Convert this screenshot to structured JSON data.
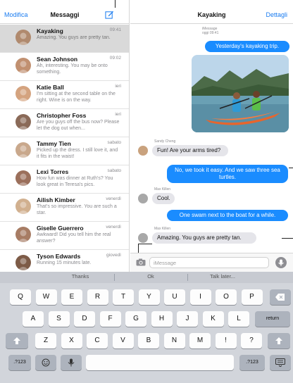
{
  "list_header": {
    "edit_label": "Modifica",
    "title": "Messaggi",
    "compose_icon": "compose-icon"
  },
  "conversations": [
    {
      "name": "Kayaking",
      "time": "09:41",
      "preview": "Amazing. You guys are pretty tan.",
      "selected": true
    },
    {
      "name": "Sean Johnson",
      "time": "09:02",
      "preview": "Ah, interesting. You may be onto something."
    },
    {
      "name": "Katie Ball",
      "time": "ieri",
      "preview": "I'm sitting at the second table on the right. Wine is on the way."
    },
    {
      "name": "Christopher Foss",
      "time": "ieri",
      "preview": "Are you guys off the bus now? Please let the dog out when..."
    },
    {
      "name": "Tammy Tien",
      "time": "sabato",
      "preview": "Picked up the dress. I still love it, and it fits in the waist!"
    },
    {
      "name": "Lexi Torres",
      "time": "sabato",
      "preview": "How fun was dinner at Ruth's? You look great in Teresa's pics."
    },
    {
      "name": "Ailish Kimber",
      "time": "venerdì",
      "preview": "That's so impressive. You are such a star."
    },
    {
      "name": "Giselle Guerrero",
      "time": "venerdì",
      "preview": "Awkward! Did you tell him the real answer?"
    },
    {
      "name": "Tyson Edwards",
      "time": "giovedì",
      "preview": "Running 15 minutes late."
    }
  ],
  "chat_header": {
    "title": "Kayaking",
    "details_label": "Dettagli"
  },
  "chat": {
    "imessage_label": "iMessage",
    "imessage_time": "oggi 09:41",
    "messages": [
      {
        "direction": "out",
        "text": "Yesterday's kayaking trip."
      },
      {
        "direction": "in",
        "sender": "Sandy Cheng",
        "text": "Fun! Are your arms tired?"
      },
      {
        "direction": "out",
        "text": "No, we took it easy. And we saw three sea turtles."
      },
      {
        "direction": "in",
        "sender": "Max Killen",
        "text": "Cool."
      },
      {
        "direction": "out",
        "text": "One swam next to the boat for a while."
      },
      {
        "direction": "in",
        "sender": "Max Killen",
        "text": "Amazing. You guys are pretty tan."
      }
    ]
  },
  "input": {
    "placeholder": "iMessage",
    "value": ""
  },
  "keyboard": {
    "suggestions": [
      "Thanks",
      "Ok",
      "Talk later..."
    ],
    "row1": [
      "Q",
      "W",
      "E",
      "R",
      "T",
      "Y",
      "U",
      "I",
      "O",
      "P"
    ],
    "row2": [
      "A",
      "S",
      "D",
      "F",
      "G",
      "H",
      "J",
      "K",
      "L"
    ],
    "row3": [
      "Z",
      "X",
      "C",
      "V",
      "B",
      "N",
      "M",
      "!",
      "?"
    ],
    "return_label": "return",
    "numbers_label": ".?123"
  },
  "colors": {
    "accent": "#1a7cf0",
    "bubble_out": "#1a8cff",
    "bubble_in": "#e5e5ea",
    "selected_row": "#d9d9d9"
  }
}
